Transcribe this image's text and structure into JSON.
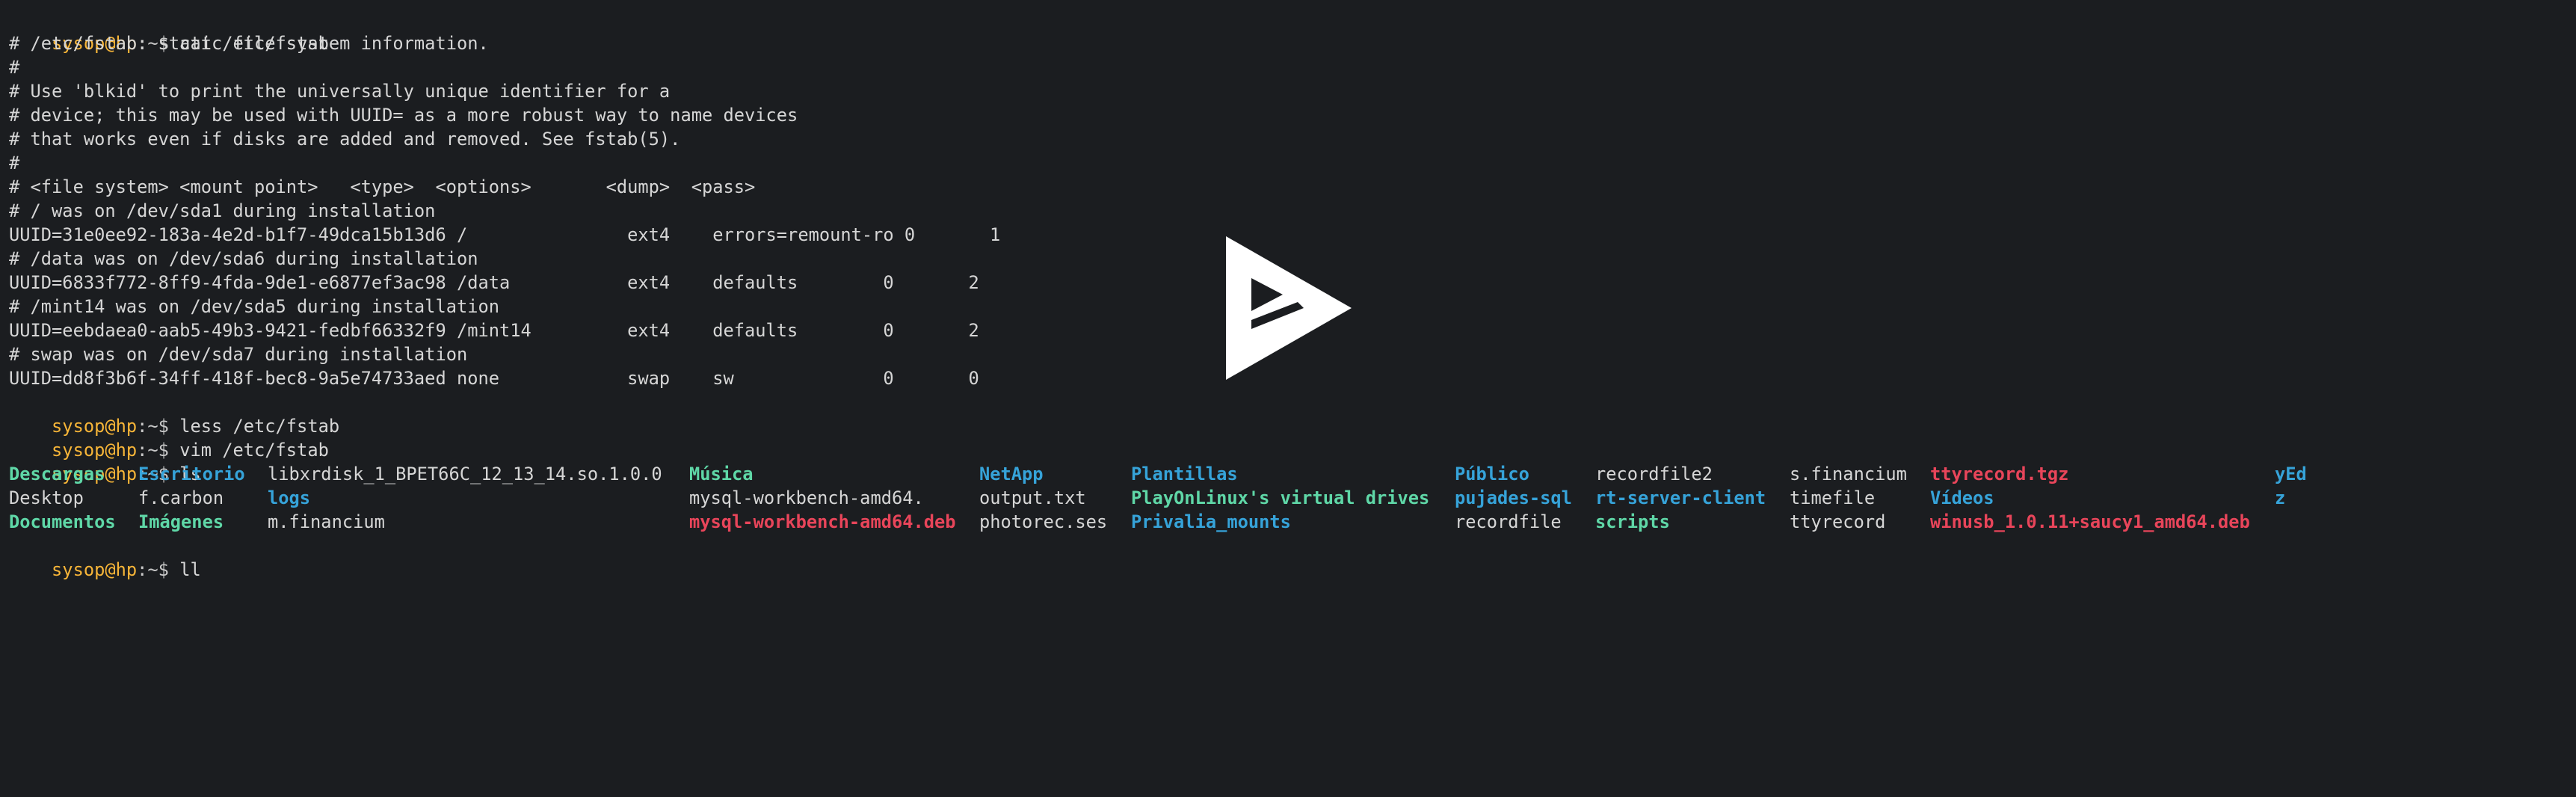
{
  "prompt": {
    "user": "sysop@hp",
    "sep": ":~$ "
  },
  "commands": {
    "cat": "cat /etc/fstab",
    "less": "less /etc/fstab",
    "vim": "vim /etc/fstab",
    "ls": "ls",
    "ll": "ll"
  },
  "fstab_lines": [
    "# /etc/fstab: static file system information.",
    "#",
    "# Use 'blkid' to print the universally unique identifier for a",
    "# device; this may be used with UUID= as a more robust way to name devices",
    "# that works even if disks are added and removed. See fstab(5).",
    "#",
    "# <file system> <mount point>   <type>  <options>       <dump>  <pass>",
    "# / was on /dev/sda1 during installation",
    "UUID=31e0ee92-183a-4e2d-b1f7-49dca15b13d6 /               ext4    errors=remount-ro 0       1",
    "# /data was on /dev/sda6 during installation",
    "UUID=6833f772-8ff9-4fda-9de1-e6877ef3ac98 /data           ext4    defaults        0       2",
    "# /mint14 was on /dev/sda5 during installation",
    "UUID=eebdaea0-aab5-49b3-9421-fedbf66332f9 /mint14         ext4    defaults        0       2",
    "# swap was on /dev/sda7 during installation",
    "UUID=dd8f3b6f-34ff-418f-bec8-9a5e74733aed none            swap    sw              0       0"
  ],
  "ls_rows": [
    [
      {
        "text": "Descargas",
        "kind": "dirg-y"
      },
      {
        "text": "Escritorio",
        "kind": "dir"
      },
      {
        "text": "libxrdisk_1_BPET66C_12_13_14.so.1.0.0",
        "kind": "plain"
      },
      {
        "text": "Música",
        "kind": "dirg"
      },
      {
        "text": "NetApp",
        "kind": "dir"
      },
      {
        "text": "Plantillas",
        "kind": "dir"
      },
      {
        "text": "Público",
        "kind": "dir"
      },
      {
        "text": "recordfile2",
        "kind": "plain"
      },
      {
        "text": "s.financium",
        "kind": "plain"
      },
      {
        "text": "ttyrecord.tgz",
        "kind": "arch"
      },
      {
        "text": "yEd",
        "kind": "dir"
      }
    ],
    [
      {
        "text": "Desktop",
        "kind": "plain"
      },
      {
        "text": "f.carbon",
        "kind": "plain"
      },
      {
        "text": "logs",
        "kind": "dir"
      },
      {
        "text": "mysql-workbench-amd64.",
        "kind": "plain"
      },
      {
        "text": "output.txt",
        "kind": "plain"
      },
      {
        "text": "PlayOnLinux's virtual drives",
        "kind": "dirg"
      },
      {
        "text": "pujades-sql",
        "kind": "dir"
      },
      {
        "text": "rt-server-client",
        "kind": "dir"
      },
      {
        "text": "timefile",
        "kind": "plain"
      },
      {
        "text": "Vídeos",
        "kind": "dir"
      },
      {
        "text": "z",
        "kind": "dir"
      }
    ],
    [
      {
        "text": "Documentos",
        "kind": "dirg"
      },
      {
        "text": "Imágenes",
        "kind": "dirg"
      },
      {
        "text": "m.financium",
        "kind": "plain"
      },
      {
        "text": "mysql-workbench-amd64.deb",
        "kind": "arch"
      },
      {
        "text": "photorec.ses",
        "kind": "plain"
      },
      {
        "text": "Privalia_mounts",
        "kind": "dir"
      },
      {
        "text": "recordfile",
        "kind": "plain"
      },
      {
        "text": "scripts",
        "kind": "dirg"
      },
      {
        "text": "ttyrecord",
        "kind": "plain"
      },
      {
        "text": "winusb_1.0.11+saucy1_amd64.deb",
        "kind": "arch"
      }
    ]
  ],
  "overlay": {
    "icon": "play-icon"
  },
  "colors": {
    "background": "#1b1d20",
    "prompt_user": "#f7b538",
    "directory": "#36a3d9",
    "directory_green": "#5fd7a7",
    "archive": "#e8455a",
    "text": "#d6d6d6"
  }
}
